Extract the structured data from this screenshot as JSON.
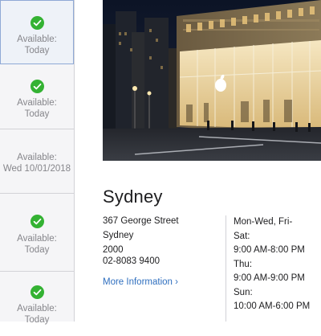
{
  "stores_list": {
    "items": [
      {
        "status": "Available:",
        "date": "Today",
        "check_icon": "check-circle-icon",
        "selected": true
      },
      {
        "status": "Available:",
        "date": "Today",
        "check_icon": "check-circle-icon"
      },
      {
        "status": "Available:",
        "date": "Wed 10/01/2018"
      },
      {
        "status": "Available:",
        "date": "Today",
        "check_icon": "check-circle-icon"
      },
      {
        "status": "Available:",
        "date": "Today",
        "check_icon": "check-circle-icon"
      }
    ]
  },
  "store": {
    "name": "Sydney",
    "address": {
      "street": "367 George Street",
      "city": "Sydney",
      "postcode": "2000",
      "phone": "02-8083 9400"
    },
    "more_info_label": "More Information ›",
    "hours": [
      "Mon-Wed, Fri-",
      "Sat:",
      "9:00 AM-8:00 PM",
      "Thu:",
      "9:00 AM-9:00 PM",
      "Sun:",
      "10:00 AM-6:00 PM"
    ]
  },
  "colors": {
    "available_green": "#34b233",
    "link_blue": "#2f6fbf",
    "muted_text": "#86868b"
  }
}
